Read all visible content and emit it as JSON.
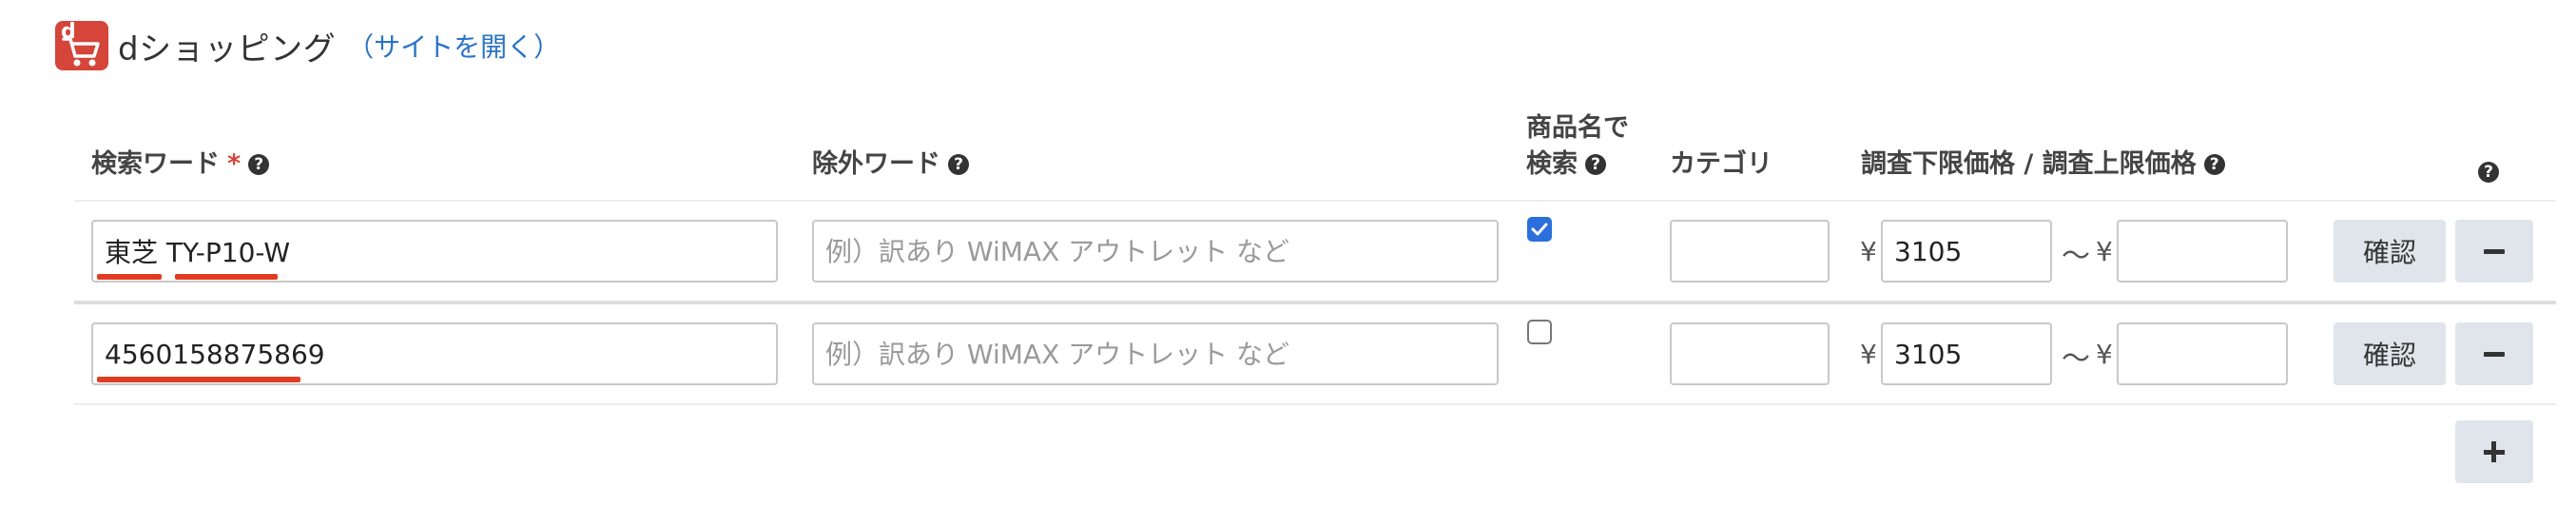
{
  "header": {
    "logo_letter": "d",
    "title": "dショッピング",
    "link_label": "（サイトを開く）"
  },
  "columns": {
    "keyword": "検索ワード",
    "required_mark": "*",
    "exclude": "除外ワード",
    "name_search_line1": "商品名で",
    "name_search_line2": "検索",
    "category": "カテゴリ",
    "price": "調査下限価格 / 調査上限価格",
    "help_glyph": "?"
  },
  "rows": [
    {
      "keyword": "東芝 TY-P10-W",
      "exclude_value": "",
      "exclude_placeholder": "例）訳あり WiMAX アウトレット など",
      "name_search_checked": true,
      "category": "",
      "yen_min": "¥",
      "price_min": "3105",
      "tilde": "〜",
      "yen_max": "¥",
      "price_max": "",
      "confirm_label": "確認"
    },
    {
      "keyword": "4560158875869",
      "exclude_value": "",
      "exclude_placeholder": "例）訳あり WiMAX アウトレット など",
      "name_search_checked": false,
      "category": "",
      "yen_min": "¥",
      "price_min": "3105",
      "tilde": "〜",
      "yen_max": "¥",
      "price_max": "",
      "confirm_label": "確認"
    }
  ],
  "colors": {
    "brand": "#d5453a",
    "link": "#2a73c7",
    "underline": "#e03c22",
    "checkbox": "#2a6fdb",
    "button_bg": "#dfe5ea"
  },
  "icons": {
    "logo": "cart-icon",
    "help": "question-circle-icon",
    "remove": "minus-icon",
    "add": "plus-icon"
  }
}
